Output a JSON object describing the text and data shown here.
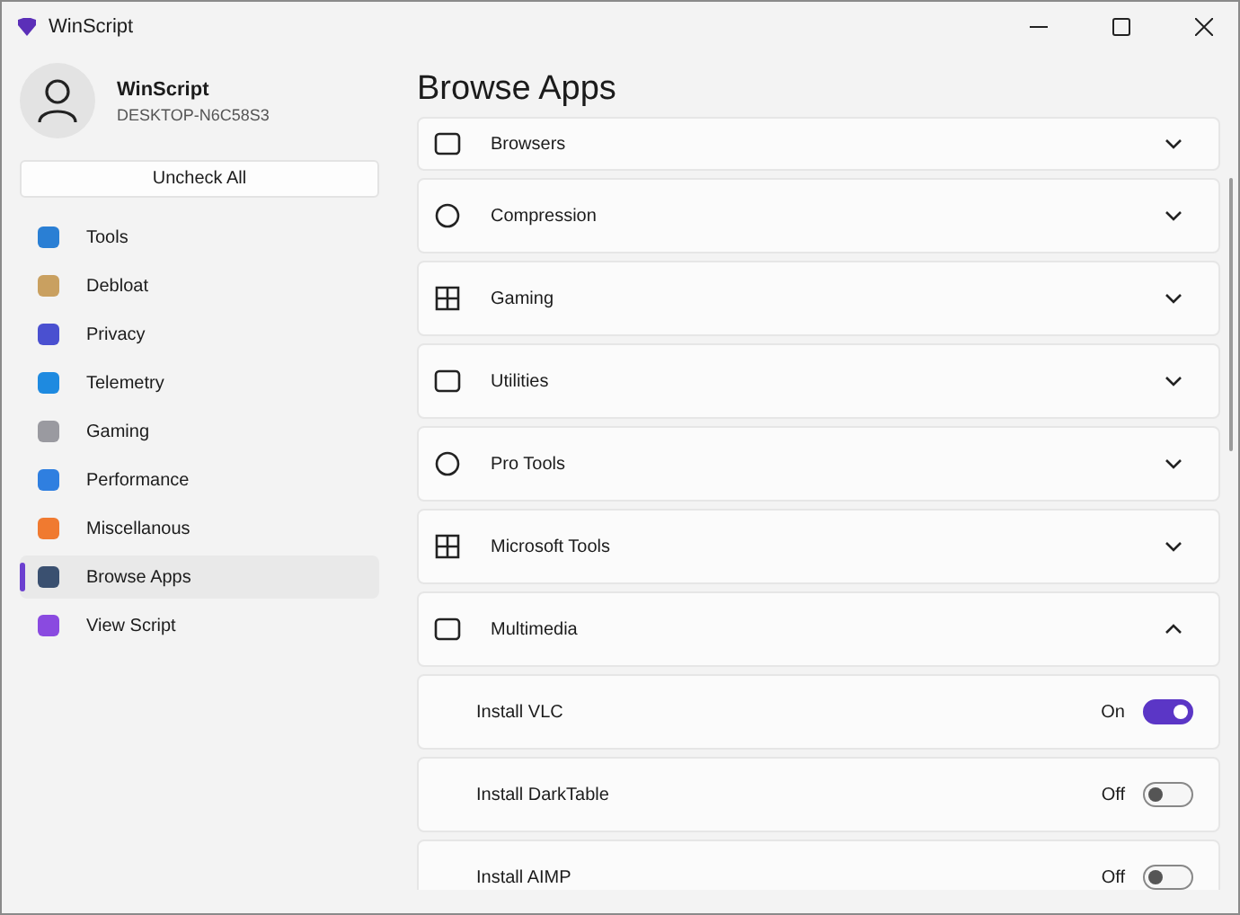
{
  "window": {
    "title": "WinScript"
  },
  "profile": {
    "name": "WinScript",
    "machine": "DESKTOP-N6C58S3"
  },
  "uncheck_button": "Uncheck All",
  "sidebar": {
    "items": [
      {
        "label": "Tools",
        "selected": false
      },
      {
        "label": "Debloat",
        "selected": false
      },
      {
        "label": "Privacy",
        "selected": false
      },
      {
        "label": "Telemetry",
        "selected": false
      },
      {
        "label": "Gaming",
        "selected": false
      },
      {
        "label": "Performance",
        "selected": false
      },
      {
        "label": "Miscellanous",
        "selected": false
      },
      {
        "label": "Browse Apps",
        "selected": true
      },
      {
        "label": "View Script",
        "selected": false
      }
    ]
  },
  "page_title": "Browse Apps",
  "sections": [
    {
      "kind": "category",
      "label": "Browsers",
      "expanded": false
    },
    {
      "kind": "category",
      "label": "Compression",
      "expanded": false
    },
    {
      "kind": "category",
      "label": "Gaming",
      "expanded": false
    },
    {
      "kind": "category",
      "label": "Utilities",
      "expanded": false
    },
    {
      "kind": "category",
      "label": "Pro Tools",
      "expanded": false
    },
    {
      "kind": "category",
      "label": "Microsoft Tools",
      "expanded": false
    },
    {
      "kind": "category",
      "label": "Multimedia",
      "expanded": true
    },
    {
      "kind": "toggle",
      "label": "Install VLC",
      "state": "On",
      "on": true
    },
    {
      "kind": "toggle",
      "label": "Install DarkTable",
      "state": "Off",
      "on": false
    },
    {
      "kind": "toggle",
      "label": "Install AIMP",
      "state": "Off",
      "on": false
    }
  ]
}
